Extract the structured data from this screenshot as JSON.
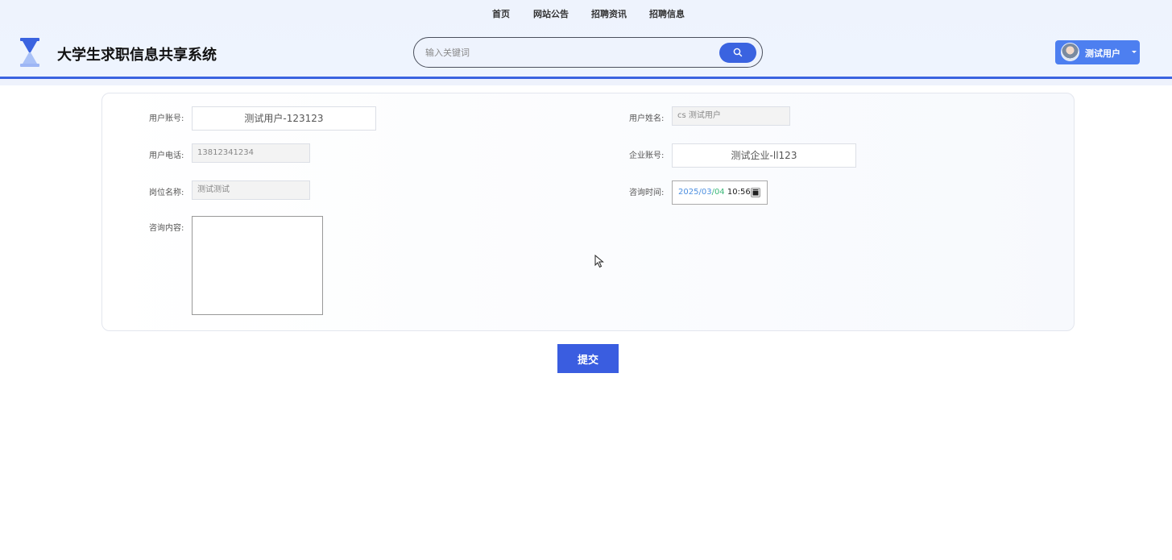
{
  "nav": {
    "items": [
      "首页",
      "网站公告",
      "招聘资讯",
      "招聘信息"
    ]
  },
  "site": {
    "title": "大学生求职信息共享系统",
    "logo_icon": "hourglass-icon"
  },
  "search": {
    "placeholder": "输入关键词",
    "button_icon": "search-icon"
  },
  "user": {
    "name": "测试用户",
    "avatar_icon": "avatar-icon"
  },
  "form": {
    "account_label": "用户账号:",
    "account_value": "测试用户-123123",
    "name_label": "用户姓名:",
    "name_value": "cs 测试用户",
    "phone_label": "用户电话:",
    "phone_value": "13812341234",
    "company_label": "企业账号:",
    "company_value": "测试企业-ll123",
    "position_label": "岗位名称:",
    "position_value": "测试测试",
    "time_label": "咨询时间:",
    "time_year": "2025",
    "time_month": "03",
    "time_day": "04",
    "time_clock": "10:56",
    "content_label": "咨询内容:",
    "content_value": ""
  },
  "actions": {
    "submit_label": "提交"
  },
  "colors": {
    "accent": "#3a63e0",
    "header_bg": "#eef3fd",
    "user_button": "#4d7ff0"
  }
}
